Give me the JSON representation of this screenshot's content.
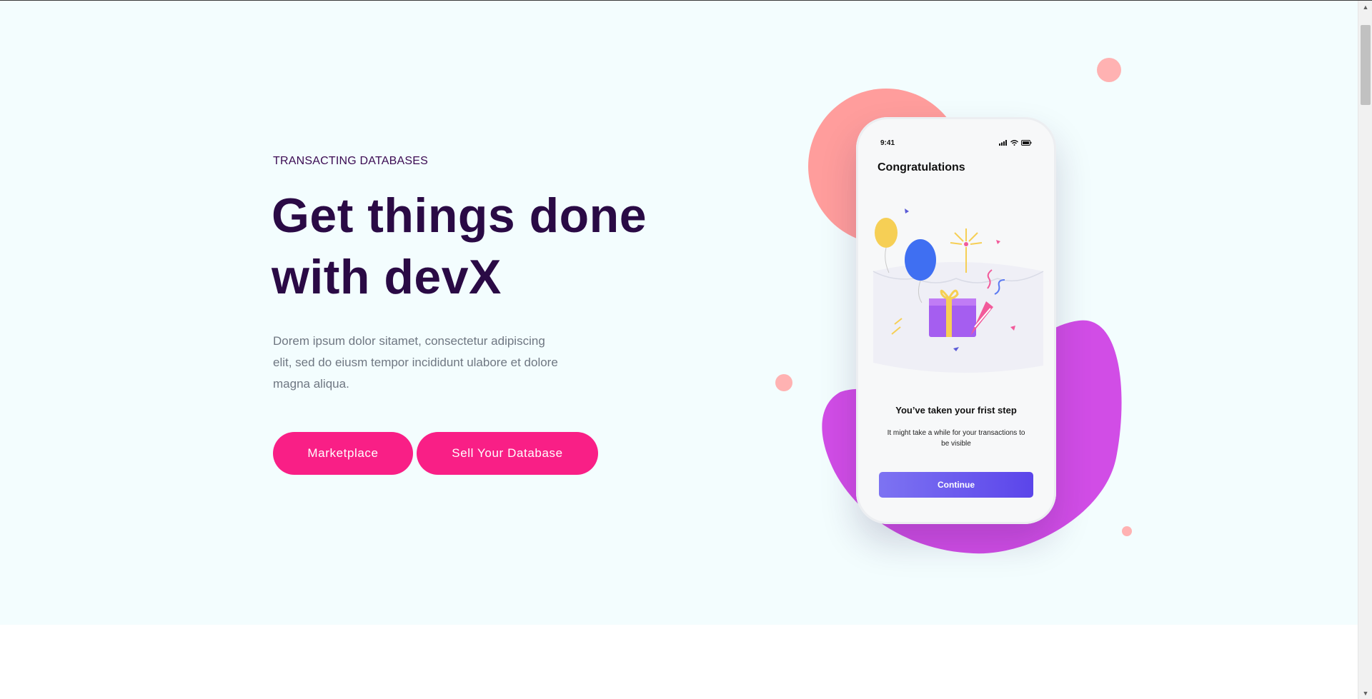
{
  "hero": {
    "eyebrow": "TRANSACTING DATABASES",
    "headline": "Get things done with devX",
    "lead": "Dorem ipsum dolor sitamet, consectetur adipiscing elit, sed do eiusm tempor incididunt ulabore et dolore magna aliqua.",
    "buttons": {
      "marketplace": "Marketplace",
      "sell": "Sell Your Database"
    }
  },
  "phone": {
    "status_time": "9:41",
    "title": "Congratulations",
    "heading": "You’ve taken your frist step",
    "subtext": "It might take a while for your transactions to be visible",
    "button": "Continue"
  },
  "colors": {
    "hero_background": "#f3fdfe",
    "primary_button": "#f91f86",
    "headline": "#2a0a45",
    "coral_blob": "#ff9b9b",
    "purple_blob": "#cf48e4",
    "continue_button": "#5b45ea"
  },
  "icons": [
    "signal-icon",
    "wifi-icon",
    "battery-icon",
    "balloon-yellow-icon",
    "balloon-blue-icon",
    "gift-box-icon",
    "party-popper-icon",
    "firework-icon",
    "scroll-up-arrow-icon",
    "scroll-down-arrow-icon"
  ]
}
